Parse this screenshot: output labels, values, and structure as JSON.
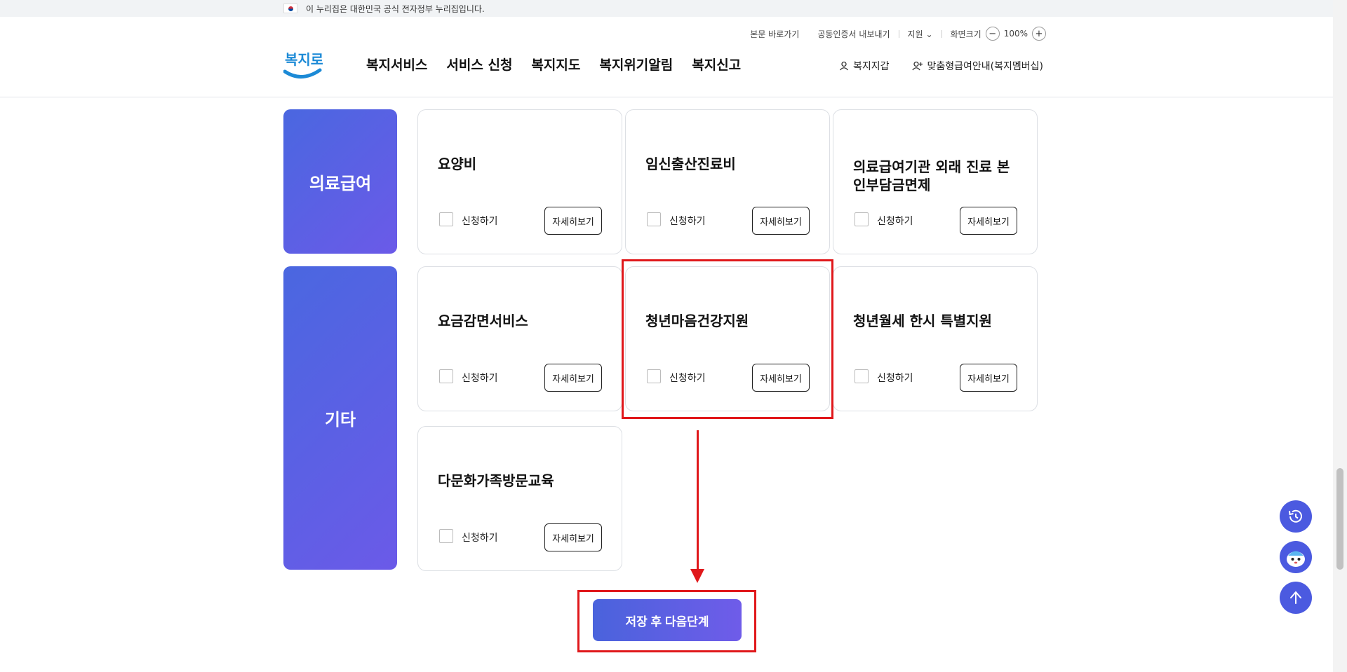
{
  "gov_notice": "이 누리집은 대한민국 공식 전자정부 누리집입니다.",
  "util": {
    "skip": "본문 바로가기",
    "cert": "공동인증서 내보내기",
    "support": "지원",
    "screen_size": "화면크기",
    "zoom_out": "−",
    "zoom_level": "100%",
    "zoom_in": "+"
  },
  "logo_text": "복지로",
  "nav": [
    "복지서비스",
    "서비스 신청",
    "복지지도",
    "복지위기알림",
    "복지신고"
  ],
  "user_links": {
    "wallet": "복지지갑",
    "custom": "맞춤형급여안내(복지멤버십)"
  },
  "categories": [
    {
      "name": "의료급여",
      "cards": [
        {
          "title": "요양비",
          "apply": "신청하기",
          "detail": "자세히보기",
          "checked": false
        },
        {
          "title": "임신출산진료비",
          "apply": "신청하기",
          "detail": "자세히보기",
          "checked": false
        },
        {
          "title": "의료급여기관 외래 진료 본인부담금면제",
          "apply": "신청하기",
          "detail": "자세히보기",
          "checked": false
        }
      ]
    },
    {
      "name": "기타",
      "cards": [
        {
          "title": "요금감면서비스",
          "apply": "신청하기",
          "detail": "자세히보기",
          "checked": false
        },
        {
          "title": "청년마음건강지원",
          "apply": "신청하기",
          "detail": "자세히보기",
          "checked": false
        },
        {
          "title": "청년월세 한시 특별지원",
          "apply": "신청하기",
          "detail": "자세히보기",
          "checked": false
        },
        {
          "title": "다문화가족방문교육",
          "apply": "신청하기",
          "detail": "자세히보기",
          "checked": false
        }
      ]
    }
  ],
  "next_button": "저장 후 다음단계",
  "float_buttons": [
    "history-icon",
    "chatbot-icon",
    "arrow-up-icon"
  ],
  "colors": {
    "accent": "#4a63dc",
    "accent_2": "#6f5ce9",
    "highlight": "#e0181b"
  }
}
